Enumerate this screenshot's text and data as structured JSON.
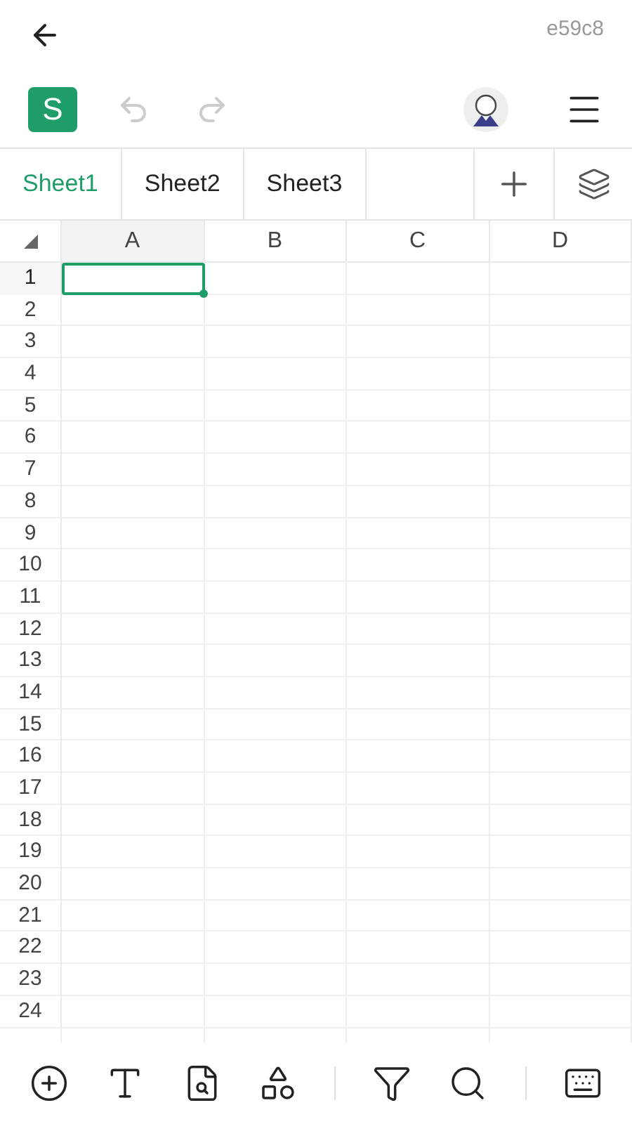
{
  "header": {
    "title": "e59c8"
  },
  "toolbar": {
    "app_letter": "S",
    "undo": {
      "disabled": true
    },
    "redo": {
      "disabled": true
    }
  },
  "tabs": [
    {
      "label": "Sheet1",
      "selected": true
    },
    {
      "label": "Sheet2",
      "selected": false
    },
    {
      "label": "Sheet3",
      "selected": false
    }
  ],
  "grid": {
    "columns": [
      {
        "label": "A",
        "selected": true
      },
      {
        "label": "B",
        "selected": false
      },
      {
        "label": "C",
        "selected": false
      },
      {
        "label": "D",
        "selected": false
      }
    ],
    "rows": [
      {
        "label": "1",
        "selected": true
      },
      {
        "label": "2",
        "selected": false
      },
      {
        "label": "3",
        "selected": false
      },
      {
        "label": "4",
        "selected": false
      },
      {
        "label": "5",
        "selected": false
      },
      {
        "label": "6",
        "selected": false
      },
      {
        "label": "7",
        "selected": false
      },
      {
        "label": "8",
        "selected": false
      },
      {
        "label": "9",
        "selected": false
      },
      {
        "label": "10",
        "selected": false
      },
      {
        "label": "11",
        "selected": false
      },
      {
        "label": "12",
        "selected": false
      },
      {
        "label": "13",
        "selected": false
      },
      {
        "label": "14",
        "selected": false
      },
      {
        "label": "15",
        "selected": false
      },
      {
        "label": "16",
        "selected": false
      },
      {
        "label": "17",
        "selected": false
      },
      {
        "label": "18",
        "selected": false
      },
      {
        "label": "19",
        "selected": false
      },
      {
        "label": "20",
        "selected": false
      },
      {
        "label": "21",
        "selected": false
      },
      {
        "label": "22",
        "selected": false
      },
      {
        "label": "23",
        "selected": false
      },
      {
        "label": "24",
        "selected": false
      }
    ]
  }
}
